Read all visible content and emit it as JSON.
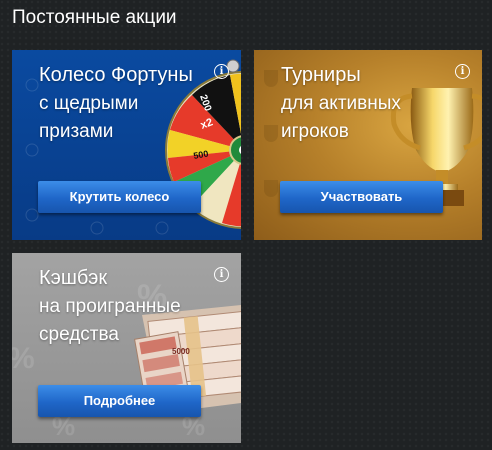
{
  "page": {
    "title": "Постоянные акции"
  },
  "promos": [
    {
      "title": "Колесо Фортуны",
      "subtitle": "с щедрыми\nпризами",
      "button_label": "Крутить колесо",
      "info_icon": "info-icon",
      "background_color": "#0a4aa0",
      "wheel_labels": [
        "200",
        "x2",
        "500",
        "$"
      ]
    },
    {
      "title": "Турниры",
      "subtitle": "для активных\nигроков",
      "button_label": "Участвовать",
      "info_icon": "info-icon",
      "background_color": "#b6802a"
    },
    {
      "title": "Кэшбэк",
      "subtitle": "на проигранные\nсредства",
      "button_label": "Подробнее",
      "info_icon": "info-icon",
      "background_color": "#9b9b9b",
      "banknote_label": "5000"
    }
  ],
  "colors": {
    "page_background": "#1f2224",
    "button": "#1f66c8"
  }
}
